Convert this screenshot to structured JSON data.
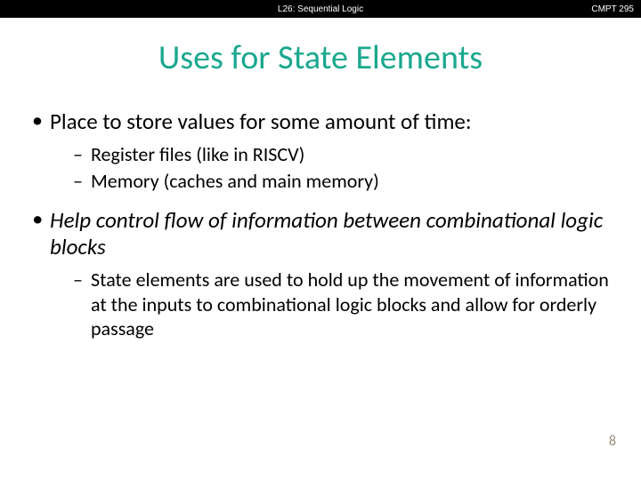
{
  "header": {
    "left": "L26: Sequential Logic",
    "right": "CMPT 295"
  },
  "title": "Uses for State Elements",
  "bullets": {
    "b1": "Place to store values for some amount of time:",
    "b1_sub1": "Register files (like in RISCV)",
    "b1_sub2": "Memory (caches and main memory)",
    "b2": "Help control flow of information between combinational logic blocks",
    "b2_sub1": "State elements are used to hold up the movement of information at the inputs to combinational logic blocks and allow for orderly passage"
  },
  "page_number": "8"
}
